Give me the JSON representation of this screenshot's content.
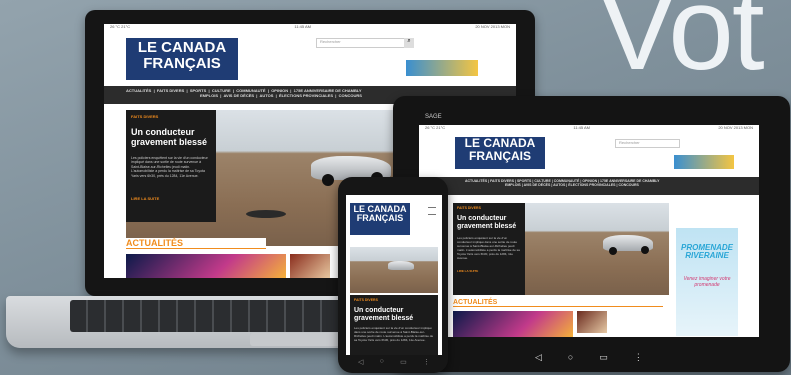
{
  "hero_word": "Vot",
  "brand": {
    "line1": "LE CANADA",
    "line2": "FRANÇAIS"
  },
  "statusbar": {
    "left": "26 °C  21°C",
    "center": "11:45 AM",
    "right": "20 NOV 2013 MON"
  },
  "search_placeholder": "Rechercher",
  "nav_items": [
    "ACTUALITÉS",
    "FAITS DIVERS",
    "SPORTS",
    "CULTURE",
    "COMMUNAUTÉ",
    "OPINION",
    "175E ANNIVERSAIRE DE CHAMBLY"
  ],
  "nav_items_row2": [
    "EMPLOIS",
    "AVIS DE DÉCÈS",
    "AUTOS",
    "ÉLECTIONS PROVINCIALES",
    "CONCOURS"
  ],
  "story": {
    "kicker": "FAITS DIVERS",
    "headline": "Un conducteur gravement blessé",
    "blurb": "Les policiers enquêtent sur la vie d'un conducteur impliqué dans une sortie de route survenue à Saint-Blaise-sur-Richelieu jeudi matin. L'automobiliste a perdu la maîtrise de sa Toyota Yaris vers 6h30, près du 1284, 11e Avenue.",
    "more": "LIRE LA SUITE"
  },
  "section_title": "ACTUALITÉS",
  "tablet_brand": "SAGE",
  "promo": {
    "title": "PROMENADE RIVERAINE",
    "subtitle": "Venez imaginer votre promenade"
  },
  "phone_nav": [
    "◁",
    "○",
    "▭",
    "⋮"
  ],
  "tablet_nav": [
    "◁",
    "○",
    "▭",
    "⋮"
  ],
  "colors": {
    "brand_blue": "#1f3c74",
    "accent_orange": "#f08c1e",
    "nav_dark": "#2c2c2c"
  }
}
